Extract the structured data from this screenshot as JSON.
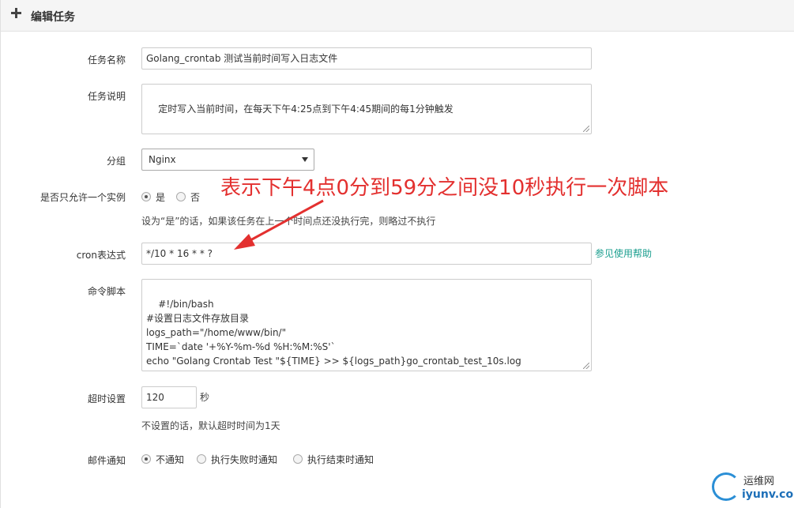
{
  "header": {
    "title": "编辑任务",
    "icon": "plus-icon"
  },
  "form": {
    "name": {
      "label": "任务名称",
      "value": "Golang_crontab 测试当前时间写入日志文件"
    },
    "description": {
      "label": "任务说明",
      "value": "定时写入当前时间，在每天下午4:25点到下午4:45期间的每1分钟触发"
    },
    "group": {
      "label": "分组",
      "selected": "Nginx"
    },
    "single_instance": {
      "label": "是否只允许一个实例",
      "options": [
        {
          "label": "是",
          "checked": true
        },
        {
          "label": "否",
          "checked": false
        }
      ],
      "help": "设为“是”的话，如果该任务在上一个时间点还没执行完，则略过不执行"
    },
    "cron": {
      "label": "cron表达式",
      "value": "*/10 * 16 * * ?",
      "help_link": "参见使用帮助"
    },
    "command": {
      "label": "命令脚本",
      "value": "#!/bin/bash\n#设置日志文件存放目录\nlogs_path=\"/home/www/bin/\"\nTIME=`date '+%Y-%m-%d %H:%M:%S'`\necho \"Golang Crontab Test \"${TIME} >> ${logs_path}go_crontab_test_10s.log"
    },
    "timeout": {
      "label": "超时设置",
      "value": "120",
      "unit": "秒",
      "help": "不设置的话，默认超时时间为1天"
    },
    "notify": {
      "label": "邮件通知",
      "options": [
        {
          "label": "不通知",
          "checked": true
        },
        {
          "label": "执行失败时通知",
          "checked": false
        },
        {
          "label": "执行结束时通知",
          "checked": false
        }
      ]
    }
  },
  "annotation": {
    "text": "表示下午4点0分到59分之间没10秒执行一次脚本",
    "color": "#e3302f"
  },
  "watermark": {
    "line1": "运维网",
    "line2": "iyunv.com"
  }
}
